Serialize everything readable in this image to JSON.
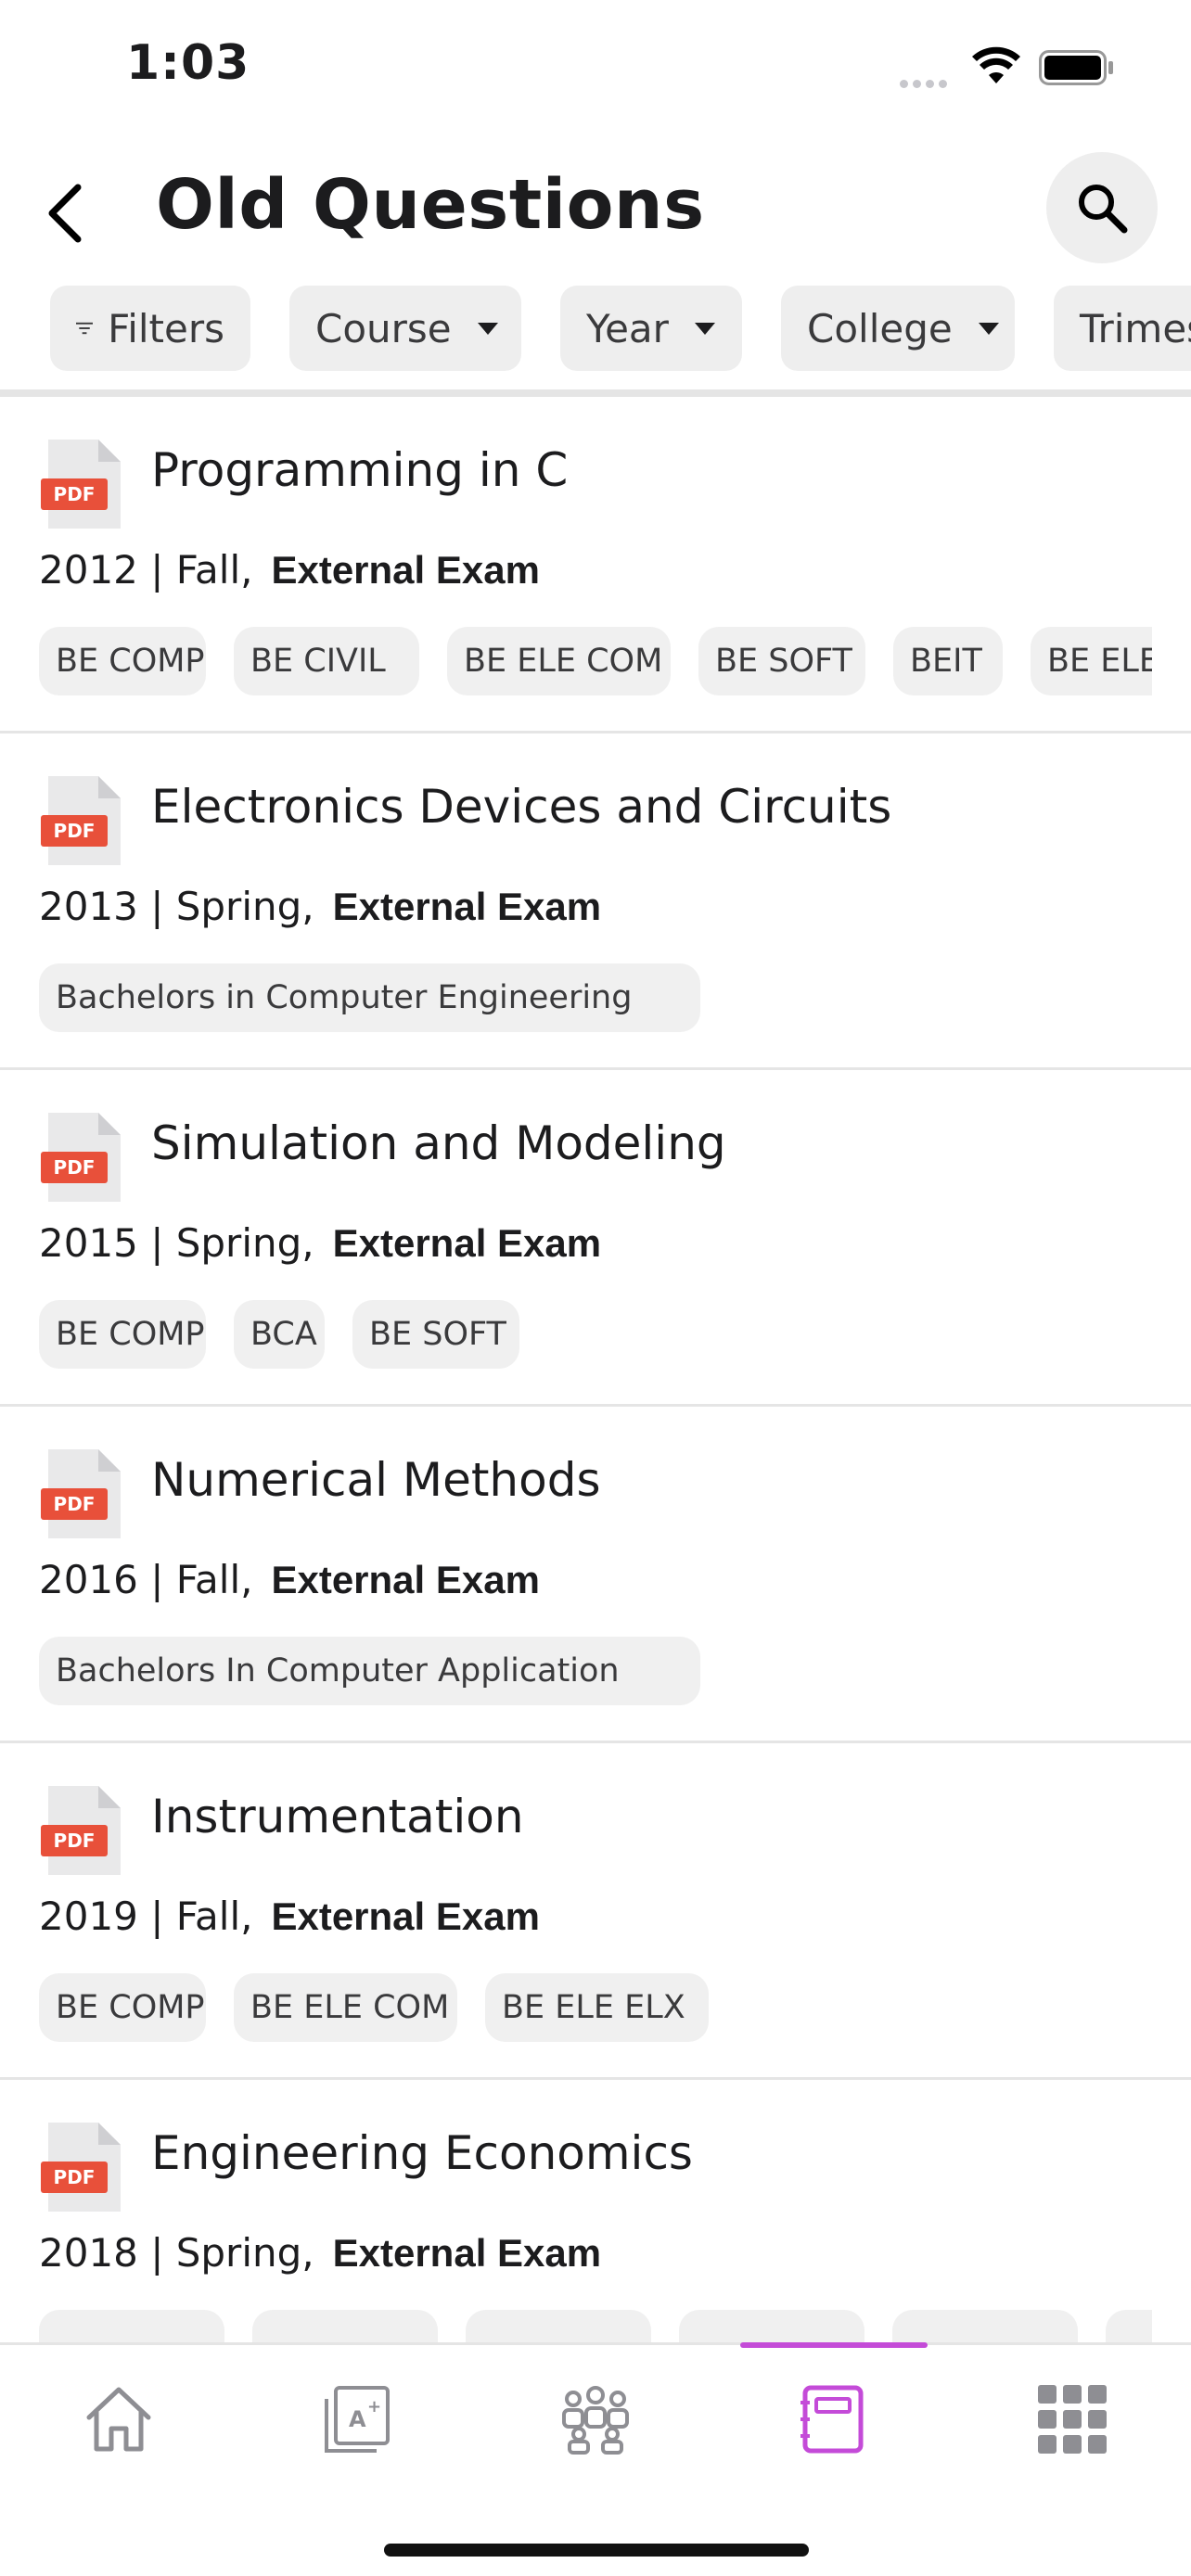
{
  "status": {
    "time": "1:03"
  },
  "header": {
    "title": "Old Questions"
  },
  "filters": [
    {
      "label": "Filters",
      "has_caret": false
    },
    {
      "label": "Course",
      "has_caret": true
    },
    {
      "label": "Year",
      "has_caret": true
    },
    {
      "label": "College",
      "has_caret": true
    },
    {
      "label": "Trimester",
      "has_caret": true
    }
  ],
  "pdf_badge": "PDF",
  "questions": [
    {
      "title": "Programming in C",
      "year_term": "2012 | Fall,",
      "exam": "External Exam",
      "tags": [
        "BE COMP",
        "BE CIVIL",
        "BE ELE COM",
        "BE SOFT",
        "BEIT",
        "BE ELE ELX"
      ]
    },
    {
      "title": "Electronics Devices and Circuits",
      "year_term": "2013 | Spring,",
      "exam": "External Exam",
      "tags": [
        "Bachelors in Computer Engineering"
      ]
    },
    {
      "title": "Simulation and Modeling",
      "year_term": "2015 | Spring,",
      "exam": "External Exam",
      "tags": [
        "BE COMP",
        "BCA",
        "BE SOFT"
      ]
    },
    {
      "title": "Numerical Methods",
      "year_term": "2016 | Fall,",
      "exam": "External Exam",
      "tags": [
        "Bachelors In Computer Application"
      ]
    },
    {
      "title": "Instrumentation",
      "year_term": "2019 | Fall,",
      "exam": "External Exam",
      "tags": [
        "BE COMP",
        "BE ELE COM",
        "BE ELE ELX"
      ]
    },
    {
      "title": "Engineering Economics",
      "year_term": "2018 | Spring,",
      "exam": "External Exam",
      "tags": [
        "",
        "",
        "",
        "",
        "",
        ""
      ]
    }
  ],
  "tabbar": {
    "items": [
      "home-icon",
      "grades-icon",
      "community-icon",
      "notebook-icon",
      "apps-grid-icon"
    ],
    "active_index": 3,
    "accent_color": "#c44bd8",
    "inactive_color": "#8e8e93"
  },
  "colors": {
    "pdf_red": "#e8503a",
    "chip_bg": "#eeeeee"
  }
}
